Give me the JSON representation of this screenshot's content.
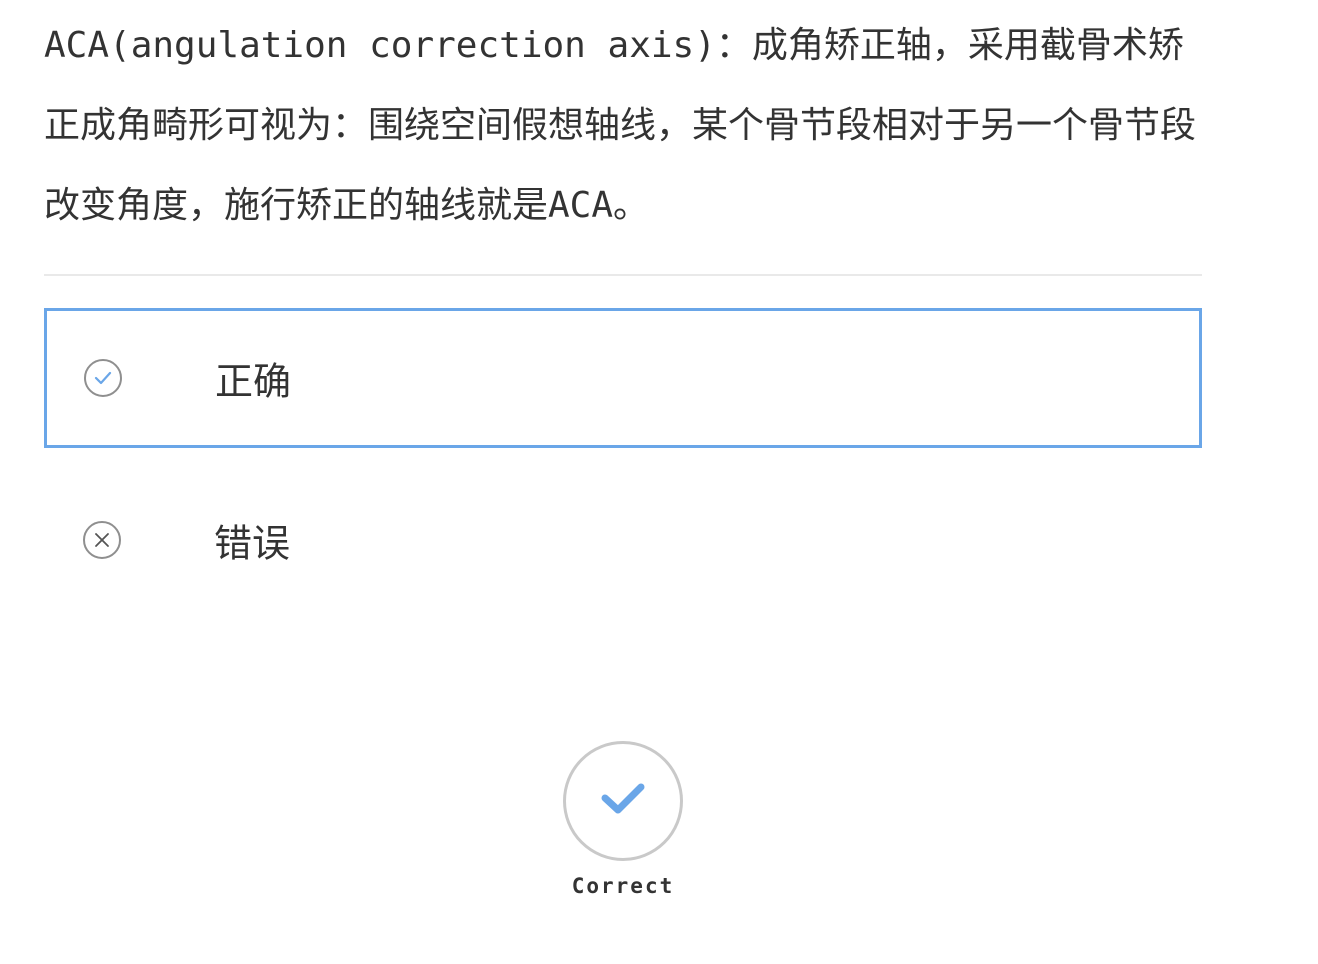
{
  "question": {
    "text": "ACA(angulation correction axis)：成角矫正轴，采用截骨术矫正成角畸形可视为：围绕空间假想轴线，某个骨节段相对于另一个骨节段改变角度，施行矫正的轴线就是ACA。"
  },
  "options": [
    {
      "label": "正确",
      "icon": "check-circle-icon",
      "selected": true
    },
    {
      "label": "错误",
      "icon": "x-circle-icon",
      "selected": false
    }
  ],
  "result": {
    "icon": "checkmark-icon",
    "label": "Correct"
  },
  "colors": {
    "accent": "#6aa6e8",
    "text": "#333333",
    "divider": "#e9e9e9",
    "icon_outline": "#8f8f8f",
    "result_outline": "#c9c9c9"
  }
}
